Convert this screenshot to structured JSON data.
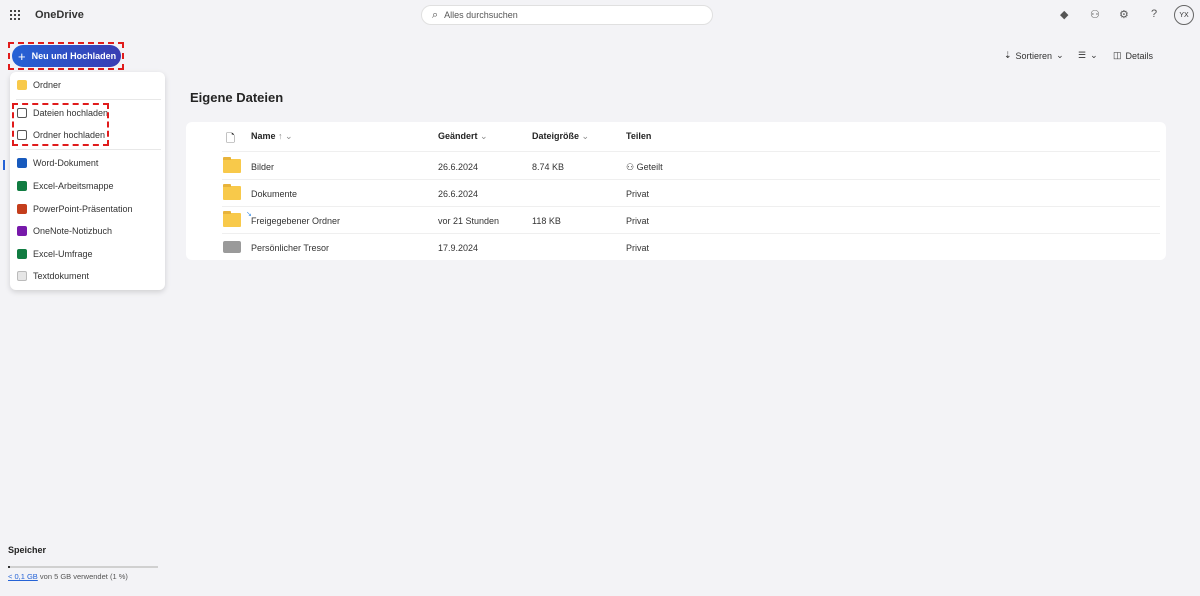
{
  "app": {
    "title": "OneDrive"
  },
  "search": {
    "placeholder": "Alles durchsuchen"
  },
  "header_icons": [
    "premium-diamond-icon",
    "share-people-icon",
    "settings-gear-icon",
    "help-icon"
  ],
  "user": {
    "initials": "YX"
  },
  "new_button": {
    "label": "Neu und Hochladen"
  },
  "menu": {
    "items": [
      {
        "label": "Ordner",
        "icon": "folder-icon"
      },
      {
        "label": "Dateien hochladen",
        "icon": "file-upload-icon"
      },
      {
        "label": "Ordner hochladen",
        "icon": "folder-upload-icon"
      },
      {
        "label": "Word-Dokument",
        "icon": "word-icon",
        "color": "#185abd"
      },
      {
        "label": "Excel-Arbeitsmappe",
        "icon": "excel-icon",
        "color": "#107c41"
      },
      {
        "label": "PowerPoint-Präsentation",
        "icon": "powerpoint-icon",
        "color": "#c43e1c"
      },
      {
        "label": "OneNote-Notizbuch",
        "icon": "onenote-icon",
        "color": "#7719aa"
      },
      {
        "label": "Excel-Umfrage",
        "icon": "excel-survey-icon",
        "color": "#107c41"
      },
      {
        "label": "Textdokument",
        "icon": "text-document-icon"
      }
    ]
  },
  "toolbar": {
    "sort": "Sortieren",
    "details": "Details"
  },
  "main": {
    "title": "Eigene Dateien",
    "columns": {
      "name": "Name",
      "sort_arrow": "↑",
      "modified": "Geändert",
      "size": "Dateigröße",
      "sharing": "Teilen"
    },
    "rows": [
      {
        "name": "Bilder",
        "modified": "26.6.2024",
        "size": "8.74 KB",
        "sharing": "Geteilt"
      },
      {
        "name": "Dokumente",
        "modified": "26.6.2024",
        "size": "",
        "sharing": "Privat"
      },
      {
        "name": "Freigegebener Ordner",
        "modified": "vor 21 Stunden",
        "size": "118 KB",
        "sharing": "Privat"
      },
      {
        "name": "Persönlicher Tresor",
        "modified": "17.9.2024",
        "size": "",
        "sharing": "Privat"
      }
    ]
  },
  "storage": {
    "title": "Speicher",
    "used": "< 0,1 GB",
    "rest": "von 5 GB verwendet (1 %)",
    "percent": 1
  }
}
